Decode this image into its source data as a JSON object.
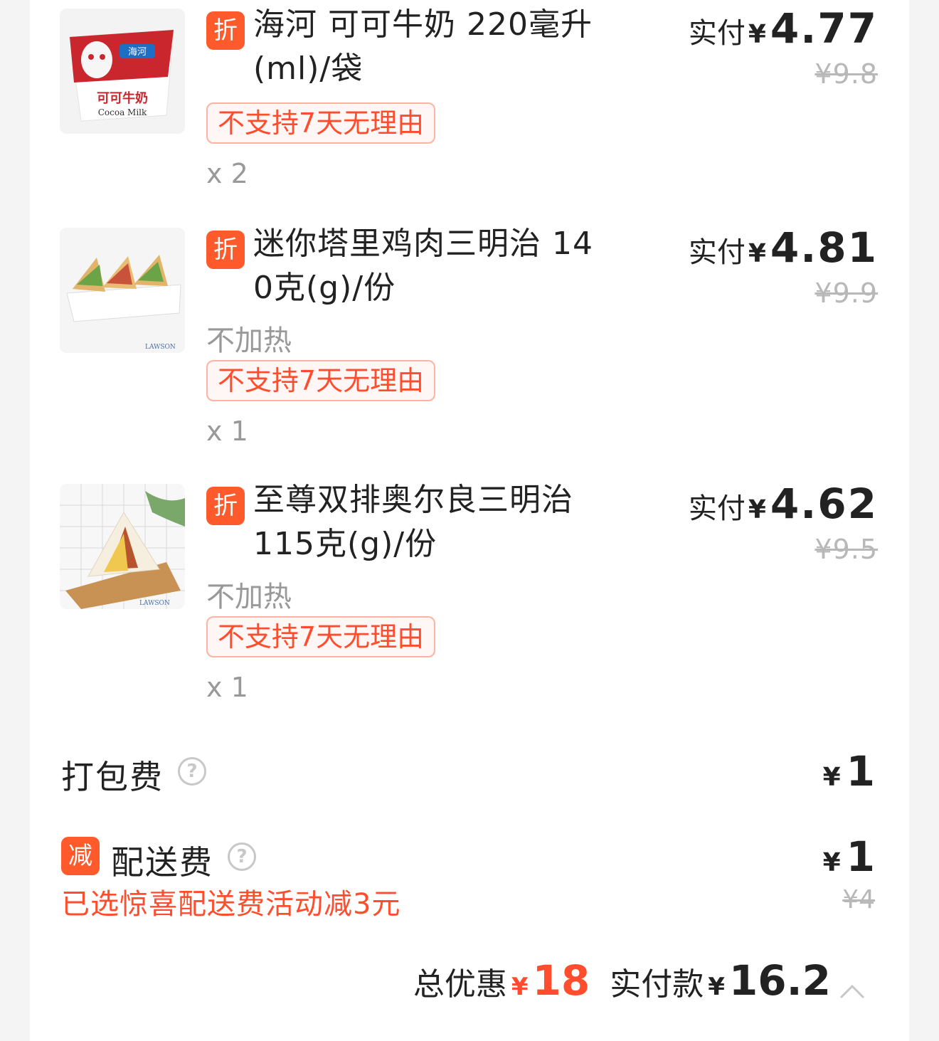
{
  "items": [
    {
      "badge": "折",
      "name_line1": "海河 可可牛奶 220毫升",
      "name_line2": "(ml)/袋",
      "attr": "",
      "policy": "不支持7天无理由",
      "qty": "x 2",
      "pay_label": "实付",
      "currency": "¥",
      "pay_amount": "4.77",
      "original": "¥9.8",
      "image_text_1": "海河",
      "image_text_2": "可可牛奶",
      "image_text_3": "Cocoa Milk",
      "image_icon": "cocoa-milk-bag-image"
    },
    {
      "badge": "折",
      "name_line1": "迷你塔里鸡肉三明治 14",
      "name_line2": "0克(g)/份",
      "attr": "不加热",
      "policy": "不支持7天无理由",
      "qty": "x 1",
      "pay_label": "实付",
      "currency": "¥",
      "pay_amount": "4.81",
      "original": "¥9.9",
      "image_text_1": "LAWSON",
      "image_icon": "chicken-sandwich-image"
    },
    {
      "badge": "折",
      "name_line1": "至尊双排奥尔良三明治",
      "name_line2": "115克(g)/份",
      "attr": "不加热",
      "policy": "不支持7天无理由",
      "qty": "x 1",
      "pay_label": "实付",
      "currency": "¥",
      "pay_amount": "4.62",
      "original": "¥9.5",
      "image_text_1": "LAWSON",
      "image_icon": "orleans-sandwich-image"
    }
  ],
  "packing_fee": {
    "title": "打包费",
    "help": "?",
    "currency": "¥",
    "amount": "1"
  },
  "delivery_fee": {
    "badge": "减",
    "title": "配送费",
    "help": "?",
    "currency": "¥",
    "amount": "1",
    "original": "¥4",
    "promo": "已选惊喜配送费活动减3元"
  },
  "summary": {
    "discount_label": "总优惠",
    "discount_currency": "¥",
    "discount_amount": "18",
    "paid_label": "实付款",
    "paid_currency": "¥",
    "paid_amount": "16.2"
  },
  "colors": {
    "accent": "#ff5a2b",
    "accent_text": "#ff4d2d",
    "muted": "#999999",
    "strike": "#b8b8b8"
  }
}
